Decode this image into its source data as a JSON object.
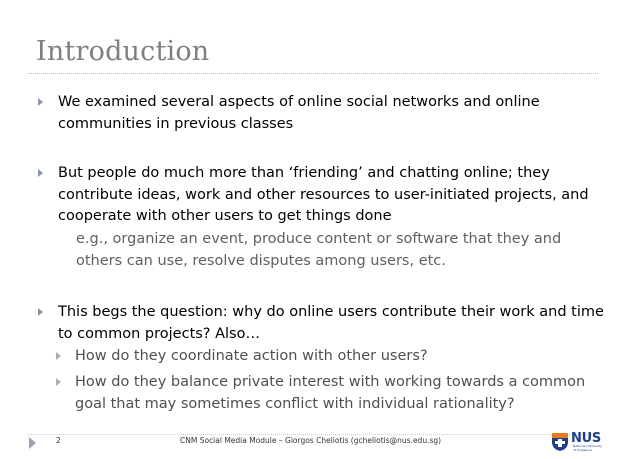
{
  "slide": {
    "title": "Introduction",
    "bullets": [
      {
        "text": "We examined several aspects of online social networks and online communities in previous classes"
      },
      {
        "text": "But people do much more than ‘friending’ and chatting online; they contribute ideas, work and other resources to user-initiated projects, and cooperate with other users to get things done",
        "detail": "e.g., organize an event, produce content or software that they and others can use, resolve disputes among users, etc."
      },
      {
        "text": "This begs the question: why do online users contribute their work and time to common projects? Also…",
        "subs": [
          "How do they coordinate action with other users?",
          "How do they balance private interest with working towards a common goal that may sometimes conflict with individual rationality?"
        ]
      }
    ]
  },
  "footer": {
    "page_number": "2",
    "text": "CNM Social Media Module – Giorgos Cheliotis (gcheliotis@nus.edu.sg)"
  },
  "logo": {
    "wordmark": "NUS",
    "subtext": "National University of Singapore",
    "colors": {
      "blue": "#1f3f86",
      "orange": "#e87722"
    }
  }
}
